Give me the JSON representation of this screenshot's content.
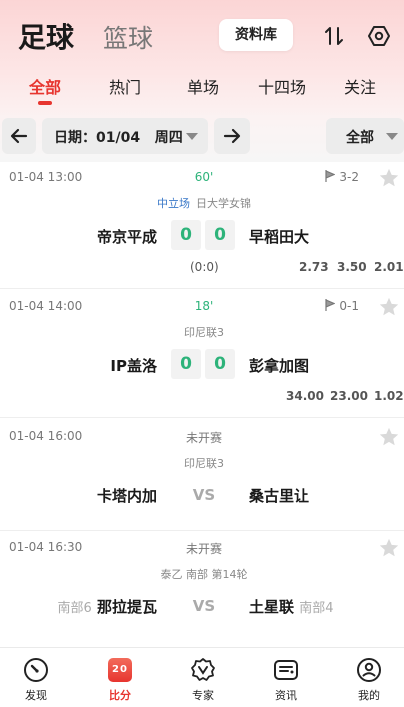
{
  "header": {
    "sport_active": "足球",
    "sport_inactive": "篮球",
    "database_button": "资料库",
    "sort_icon": "sort-arrows-icon",
    "settings_icon": "hexagon-settings-icon"
  },
  "tabs": [
    {
      "label": "全部",
      "active": true
    },
    {
      "label": "热门",
      "active": false
    },
    {
      "label": "单场",
      "active": false
    },
    {
      "label": "十四场",
      "active": false
    },
    {
      "label": "关注",
      "active": false
    }
  ],
  "filter": {
    "date_label": "日期：01/04",
    "weekday": "周四",
    "all_label": "全部"
  },
  "matches": [
    {
      "time": "01-04 13:00",
      "status": "60'",
      "live": true,
      "corner": "3-2",
      "neutral": "中立场",
      "league": "日大学女锦",
      "home": "帝京平成",
      "away": "早稻田大",
      "home_score": "0",
      "away_score": "0",
      "halftime": "(0:0)",
      "odds": [
        "2.73",
        "3.50",
        "2.01"
      ]
    },
    {
      "time": "01-04 14:00",
      "status": "18'",
      "live": true,
      "corner": "0-1",
      "league": "印尼联3",
      "home": "IP盖洛",
      "away": "彭拿加图",
      "home_score": "0",
      "away_score": "0",
      "odds": [
        "34.00",
        "23.00",
        "1.02"
      ]
    },
    {
      "time": "01-04 16:00",
      "status": "未开赛",
      "live": false,
      "league": "印尼联3",
      "home": "卡塔内加",
      "away": "桑古里让",
      "vs": "VS"
    },
    {
      "time": "01-04 16:30",
      "status": "未开赛",
      "live": false,
      "league": "泰乙 南部 第14轮",
      "home": "那拉提瓦",
      "home_rank": "南部6",
      "away": "土星联",
      "away_rank": "南部4",
      "vs": "VS"
    }
  ],
  "bottom_nav": [
    {
      "label": "发现",
      "icon": "compass-gauge-icon",
      "active": false
    },
    {
      "label": "比分",
      "icon": "scoreboard-icon",
      "active": true,
      "badge": "20"
    },
    {
      "label": "专家",
      "icon": "expert-badge-icon",
      "active": false
    },
    {
      "label": "资讯",
      "icon": "news-card-icon",
      "active": false
    },
    {
      "label": "我的",
      "icon": "profile-icon",
      "active": false
    }
  ],
  "colors": {
    "accent": "#e7352f",
    "live": "#2db37a",
    "neutral": "#3a78c8"
  }
}
